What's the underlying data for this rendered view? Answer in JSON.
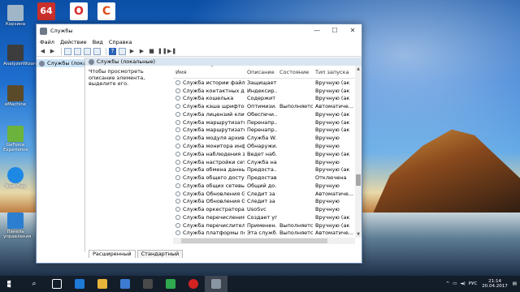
{
  "desktop": {
    "icons": [
      {
        "label": "Корзина",
        "color": "#9fb6c8"
      },
      {
        "label": "AnalyzerWizard",
        "color": "#3d3d3d"
      },
      {
        "label": "eMachine",
        "color": "#5a4a2a"
      },
      {
        "label": "GeForce Experience",
        "color": "#6cb33e"
      },
      {
        "label": "Neat Bag",
        "color": "#1e88e5"
      },
      {
        "label": "Панель управления",
        "color": "#2c7fd0"
      }
    ],
    "top_icons": [
      {
        "text": "64",
        "color": "#c9302c"
      },
      {
        "text": "O",
        "color": "#d92b2b"
      },
      {
        "text": "C",
        "color": "#e24c1b"
      }
    ]
  },
  "window": {
    "title": "Службы",
    "controls": {
      "minimize": "—",
      "maximize": "☐",
      "close": "✕"
    },
    "menu": [
      "Файл",
      "Действие",
      "Вид",
      "Справка"
    ],
    "tree_node": "Службы (локальн",
    "main_header": "Службы (локальные)",
    "description": "Чтобы просмотреть описание элемента, выделите его.",
    "columns": [
      "Имя",
      "Описание",
      "Состояние",
      "Тип запуска"
    ],
    "rows": [
      {
        "name": "Служба истории файлов",
        "desc": "Защищает...",
        "state": "",
        "type": "Вручную (ак"
      },
      {
        "name": "Служба контактных данны...",
        "desc": "Индексир...",
        "state": "",
        "type": "Вручную (ак"
      },
      {
        "name": "Служба кошелька",
        "desc": "Содержит ...",
        "state": "",
        "type": "Вручную (ак"
      },
      {
        "name": "Служба кэша шрифтов W...",
        "desc": "Оптимизи...",
        "state": "Выполняется",
        "type": "Автоматиче..."
      },
      {
        "name": "Служба лицензий клиента...",
        "desc": "Обеспечи...",
        "state": "",
        "type": "Вручную (ак"
      },
      {
        "name": "Служба маршрутизатора ...",
        "desc": "Перенапр...",
        "state": "",
        "type": "Вручную (ак"
      },
      {
        "name": "Служба маршрутизатора ...",
        "desc": "Перенапр...",
        "state": "",
        "type": "Вручную (ак"
      },
      {
        "name": "Служба модуля архиваци...",
        "desc": "Служба W...",
        "state": "",
        "type": "Вручную"
      },
      {
        "name": "Служба монитора инфрак...",
        "desc": "Обнаружи...",
        "state": "",
        "type": "Вручную"
      },
      {
        "name": "Служба наблюдения за да...",
        "desc": "Ведет наб...",
        "state": "",
        "type": "Вручную (ак"
      },
      {
        "name": "Служба настройки сети",
        "desc": "Служба на...",
        "state": "",
        "type": "Вручную"
      },
      {
        "name": "Служба обмена данными ...",
        "desc": "Предоста...",
        "state": "",
        "type": "Вручную (ак"
      },
      {
        "name": "Служба общего доступа к ...",
        "desc": "Предостав...",
        "state": "",
        "type": "Отключена"
      },
      {
        "name": "Служба общих сетевых р...",
        "desc": "Общий до...",
        "state": "",
        "type": "Вручную"
      },
      {
        "name": "Служба Обновления Googl...",
        "desc": "Следит за ...",
        "state": "",
        "type": "Автоматиче..."
      },
      {
        "name": "Служба Обновления Googl...",
        "desc": "Следит за ...",
        "state": "",
        "type": "Вручную"
      },
      {
        "name": "Служба оркестратора обн...",
        "desc": "UsoSvc",
        "state": "",
        "type": "Вручную"
      },
      {
        "name": "Служба перечисления ус...",
        "desc": "Создает уп...",
        "state": "",
        "type": "Вручную (ак"
      },
      {
        "name": "Служба перечислителя пе...",
        "desc": "Применен...",
        "state": "Выполняется",
        "type": "Вручную (ак"
      },
      {
        "name": "Служба платформы подк...",
        "desc": "Эта служб...",
        "state": "Выполняется",
        "type": "Автоматиче..."
      },
      {
        "name": "Служба поддержки Blueto...",
        "desc": "Служба Bl...",
        "state": "",
        "type": "Вручную (ак"
      }
    ],
    "tabs": [
      "Расширенный",
      "Стандартный"
    ]
  },
  "taskbar": {
    "search_icon": "⌕",
    "lang": "РУС",
    "time": "21:14",
    "date": "20.04.2017"
  }
}
